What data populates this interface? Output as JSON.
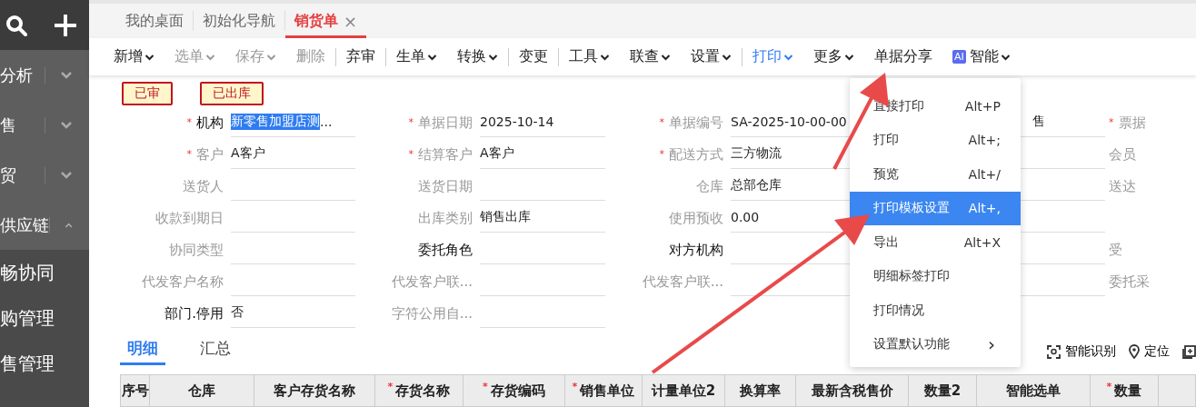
{
  "sidebar": {
    "items": [
      {
        "label": "分析",
        "expanded": false
      },
      {
        "label": "售",
        "expanded": false
      },
      {
        "label": "贸",
        "expanded": false
      },
      {
        "label": "供应链",
        "expanded": true,
        "children": [
          {
            "label": "畅协同"
          },
          {
            "label": "购管理"
          },
          {
            "label": "售管理"
          }
        ]
      }
    ]
  },
  "tabs": [
    {
      "label": "我的桌面",
      "selected": false,
      "closable": false
    },
    {
      "label": "初始化导航",
      "selected": false,
      "closable": false
    },
    {
      "label": "销货单",
      "selected": true,
      "closable": true,
      "close": "×"
    }
  ],
  "toolbar": [
    {
      "label": "新增",
      "caret": true,
      "disabled": false,
      "active": false,
      "separator_before": false
    },
    {
      "label": "选单",
      "caret": true,
      "disabled": true,
      "active": false,
      "separator_before": false
    },
    {
      "label": "保存",
      "caret": true,
      "disabled": true,
      "active": false,
      "separator_before": false
    },
    {
      "label": "删除",
      "caret": false,
      "disabled": true,
      "active": false,
      "separator_before": false
    },
    {
      "label": "弃审",
      "caret": false,
      "disabled": false,
      "active": false,
      "separator_before": true
    },
    {
      "label": "生单",
      "caret": true,
      "disabled": false,
      "active": false,
      "separator_before": true
    },
    {
      "label": "转换",
      "caret": true,
      "disabled": false,
      "active": false,
      "separator_before": false
    },
    {
      "label": "变更",
      "caret": false,
      "disabled": false,
      "active": false,
      "separator_before": true
    },
    {
      "label": "工具",
      "caret": true,
      "disabled": false,
      "active": false,
      "separator_before": true
    },
    {
      "label": "联查",
      "caret": true,
      "disabled": false,
      "active": false,
      "separator_before": false
    },
    {
      "label": "设置",
      "caret": true,
      "disabled": false,
      "active": false,
      "separator_before": false
    },
    {
      "label": "打印",
      "caret": true,
      "disabled": false,
      "active": true,
      "separator_before": true
    },
    {
      "label": "更多",
      "caret": true,
      "disabled": false,
      "active": false,
      "separator_before": false
    },
    {
      "label": "单据分享",
      "caret": false,
      "disabled": false,
      "active": false,
      "separator_before": false
    },
    {
      "label": "智能",
      "badge": "AI",
      "caret": true,
      "disabled": false,
      "active": false,
      "separator_before": false
    }
  ],
  "status_badges": [
    "已审",
    "已出库"
  ],
  "required_mark": "*",
  "form": {
    "columns": [
      {
        "fields": [
          {
            "kind": "field",
            "label": "机构",
            "value": "新零售加盟店测",
            "value_more": "...",
            "required": true,
            "disabled": false,
            "highlighted": true
          },
          {
            "kind": "field",
            "label": "客户",
            "value": "A客户",
            "required": true,
            "disabled": true
          },
          {
            "kind": "field",
            "label": "送货人",
            "required": false,
            "disabled": true
          },
          {
            "kind": "field",
            "label": "收款到期日",
            "required": false,
            "disabled": true
          },
          {
            "kind": "field",
            "label": "协同类型",
            "required": false,
            "disabled": true
          },
          {
            "kind": "field",
            "label": "代发客户名称",
            "required": false,
            "disabled": true
          },
          {
            "kind": "field",
            "label": "部门.停用",
            "value": "否",
            "required": false,
            "disabled": false
          }
        ]
      },
      {
        "fields": [
          {
            "kind": "field",
            "label": "单据日期",
            "value": "2025-10-14",
            "required": true,
            "disabled": true
          },
          {
            "kind": "field",
            "label": "结算客户",
            "value": "A客户",
            "required": true,
            "disabled": true
          },
          {
            "kind": "field",
            "label": "送货日期",
            "required": false,
            "disabled": true
          },
          {
            "kind": "field",
            "label": "出库类别",
            "value": "销售出库",
            "required": false,
            "disabled": true
          },
          {
            "kind": "field",
            "label": "委托角色",
            "required": false,
            "disabled": false
          },
          {
            "kind": "field",
            "label": "代发客户联...",
            "required": false,
            "disabled": true
          },
          {
            "kind": "field",
            "label": "字符公用自...",
            "required": false,
            "disabled": true
          }
        ]
      },
      {
        "fields": [
          {
            "kind": "field",
            "label": "单据编号",
            "value": "SA-2025-10-00-00",
            "required": true,
            "disabled": true
          },
          {
            "kind": "field",
            "label": "配送方式",
            "value": "三方物流",
            "required": true,
            "disabled": true
          },
          {
            "kind": "field",
            "label": "仓库",
            "value": "总部仓库",
            "required": false,
            "disabled": true
          },
          {
            "kind": "field",
            "label": "使用预收",
            "value": "0.00",
            "required": false,
            "disabled": true
          },
          {
            "kind": "field",
            "label": "对方机构",
            "required": false,
            "disabled": false
          },
          {
            "kind": "field",
            "label": "代发客户联...",
            "required": false,
            "disabled": true
          },
          {
            "kind": "blank"
          }
        ]
      },
      {
        "fields": [
          {
            "kind": "value_only",
            "value": "售"
          },
          {
            "kind": "value_only"
          },
          {
            "kind": "value_only"
          },
          {
            "kind": "value_only"
          },
          {
            "kind": "value_only"
          },
          {
            "kind": "value_only"
          },
          {
            "kind": "blank"
          }
        ]
      },
      {
        "fields": [
          {
            "kind": "label_only",
            "label": "票据",
            "required": true
          },
          {
            "kind": "label_only",
            "label": "会员",
            "required": false
          },
          {
            "kind": "label_only",
            "label": "送达",
            "required": false
          },
          {
            "kind": "blank"
          },
          {
            "kind": "label_only",
            "label": "受",
            "required": false
          },
          {
            "kind": "label_only",
            "label": "委托采",
            "required": false
          },
          {
            "kind": "blank"
          }
        ]
      }
    ]
  },
  "print_menu": {
    "items": [
      {
        "label": "直接打印",
        "shortcut": "Alt+P",
        "selected": false,
        "submenu": false
      },
      {
        "label": "打印",
        "shortcut": "Alt+;",
        "selected": false,
        "submenu": false
      },
      {
        "label": "预览",
        "shortcut": "Alt+/",
        "selected": false,
        "submenu": false
      },
      {
        "label": "打印模板设置",
        "shortcut": "Alt+,",
        "selected": true,
        "submenu": false
      },
      {
        "label": "导出",
        "shortcut": "Alt+X",
        "selected": false,
        "submenu": false
      },
      {
        "label": "明细标签打印",
        "selected": false,
        "submenu": false
      },
      {
        "label": "打印情况",
        "selected": false,
        "submenu": false
      },
      {
        "label": "设置默认功能",
        "selected": false,
        "submenu": true,
        "submenu_mark": "›"
      }
    ]
  },
  "detail_tabs": [
    {
      "label": "明细",
      "selected": true
    },
    {
      "label": "汇总",
      "selected": false
    }
  ],
  "detail_tools": [
    {
      "kind": "scan",
      "label": "智能识别"
    },
    {
      "kind": "pin",
      "label": "定位"
    },
    {
      "kind": "add"
    }
  ],
  "table": {
    "columns": [
      {
        "label": "序号",
        "required": false
      },
      {
        "label": "仓库",
        "required": false
      },
      {
        "label": "客户存货名称",
        "required": false
      },
      {
        "label": "存货名称",
        "required": true
      },
      {
        "label": "存货编码",
        "required": true
      },
      {
        "label": "销售单位",
        "required": true
      },
      {
        "label": "计量单位2",
        "required": false
      },
      {
        "label": "换算率",
        "required": false
      },
      {
        "label": "最新含税售价",
        "required": false
      },
      {
        "label": "数量2",
        "required": false
      },
      {
        "label": "智能选单",
        "required": false
      },
      {
        "label": "数量",
        "required": true
      }
    ]
  }
}
